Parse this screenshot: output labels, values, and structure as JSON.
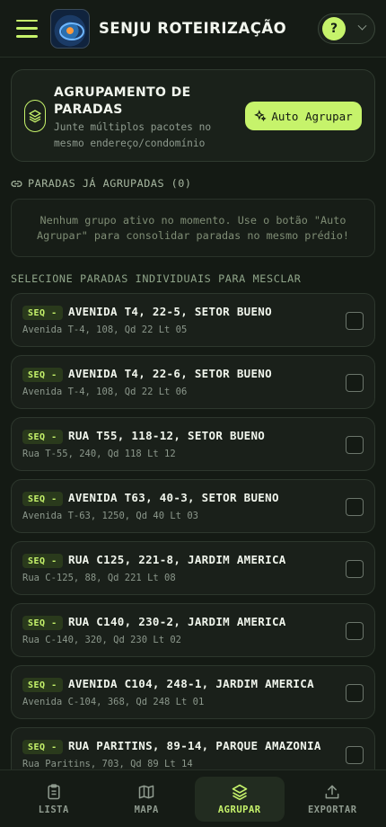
{
  "header": {
    "title": "SENJU ROTEIRIZAÇÃO",
    "help_label": "?",
    "icons": {
      "menu": "hamburger-icon",
      "logo": "app-logo",
      "dropdown": "chevron-down-icon"
    }
  },
  "group_card": {
    "title": "AGRUPAMENTO DE PARADAS",
    "subtitle": "Junte múltiplos pacotes no mesmo endereço/condomínio",
    "button_label": "Auto Agrupar",
    "icon": "layers-icon",
    "button_icon": "sparkles-icon"
  },
  "grouped_section": {
    "title": "PARADAS JÁ AGRUPADAS (0)",
    "icon": "link-icon",
    "empty_message": "Nenhum grupo ativo no momento. Use o botão \"Auto Agrupar\" para consolidar paradas no mesmo prédio!"
  },
  "select_section": {
    "title": "SELECIONE PARADAS INDIVIDUAIS PARA MESCLAR"
  },
  "stops": [
    {
      "seq": "SEQ -",
      "title": "AVENIDA T4, 22-5, SETOR BUENO",
      "address": "Avenida T-4, 108, Qd 22 Lt 05",
      "checked": false
    },
    {
      "seq": "SEQ -",
      "title": "AVENIDA T4, 22-6, SETOR BUENO",
      "address": "Avenida T-4, 108, Qd 22 Lt 06",
      "checked": false
    },
    {
      "seq": "SEQ -",
      "title": "RUA T55, 118-12, SETOR BUENO",
      "address": "Rua T-55, 240, Qd 118 Lt 12",
      "checked": false
    },
    {
      "seq": "SEQ -",
      "title": "AVENIDA T63, 40-3, SETOR BUENO",
      "address": "Avenida T-63, 1250, Qd 40 Lt 03",
      "checked": false
    },
    {
      "seq": "SEQ -",
      "title": "RUA C125, 221-8, JARDIM AMERICA",
      "address": "Rua C-125, 88, Qd 221 Lt 08",
      "checked": false
    },
    {
      "seq": "SEQ -",
      "title": "RUA C140, 230-2, JARDIM AMERICA",
      "address": "Rua C-140, 320, Qd 230 Lt 02",
      "checked": false
    },
    {
      "seq": "SEQ -",
      "title": "AVENIDA C104, 248-1, JARDIM AMERICA",
      "address": "Avenida C-104, 368, Qd 248 Lt 01",
      "checked": false
    },
    {
      "seq": "SEQ -",
      "title": "RUA PARITINS, 89-14, PARQUE AMAZONIA",
      "address": "Rua Paritins, 703, Qd 89 Lt 14",
      "checked": false
    }
  ],
  "nav": [
    {
      "label": "LISTA",
      "icon": "clipboard-icon",
      "active": false
    },
    {
      "label": "MAPA",
      "icon": "map-icon",
      "active": false
    },
    {
      "label": "AGRUPAR",
      "icon": "layers-icon",
      "active": true
    },
    {
      "label": "EXPORTAR",
      "icon": "upload-icon",
      "active": false
    }
  ],
  "colors": {
    "accent": "#c6f36b",
    "background": "#141a14",
    "card": "#1a211a"
  }
}
